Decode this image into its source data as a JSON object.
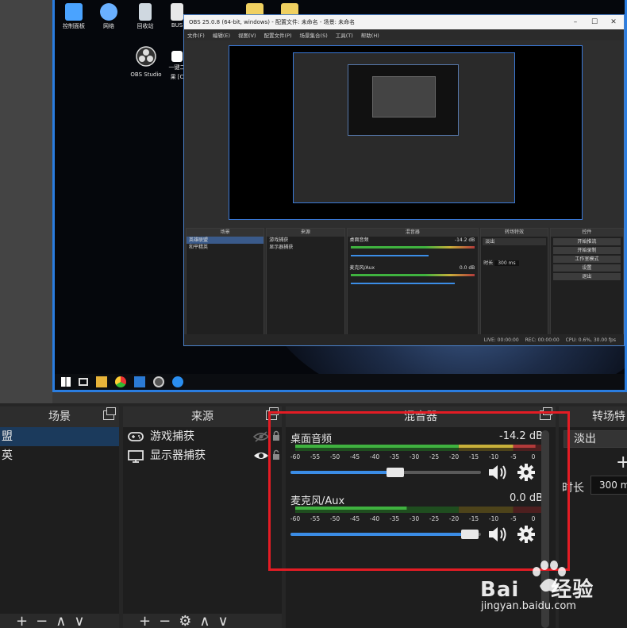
{
  "desktop": {
    "icons": [
      {
        "label": "控制面板",
        "color": "#4aa3ff"
      },
      {
        "label": "网络",
        "color": "#6ab0ff"
      },
      {
        "label": "回收站",
        "color": "#cfd8e0"
      },
      {
        "label": "BUS",
        "color": "#e8e8e8"
      },
      {
        "label": "",
        "color": "#f0d060"
      },
      {
        "label": "",
        "color": "#f0d060"
      }
    ],
    "obs_icon_label": "OBS Studio",
    "side_icon_label": "一键二",
    "side_icon_label2": "果 [C"
  },
  "nested_window": {
    "title": "OBS 25.0.8 (64-bit, windows) - 配置文件: 未命名 - 场景: 未命名",
    "menu": [
      "文件(F)",
      "编辑(E)",
      "视图(V)",
      "配置文件(P)",
      "场景集合(S)",
      "工具(T)",
      "帮助(H)"
    ],
    "panels": {
      "scenes_header": "场景",
      "scenes": [
        "英雄联盟",
        "和平精英"
      ],
      "sources_header": "来源",
      "sources": [
        "游戏捕获",
        "显示器捕获"
      ],
      "mixer_header": "混音器",
      "mixer_ch1": "桌面音频",
      "mixer_ch1_db": "-14.2 dB",
      "mixer_ch2": "麦克风/Aux",
      "mixer_ch2_db": "0.0 dB",
      "transitions_header": "转场特效",
      "transition_value": "淡出",
      "duration_label": "时长",
      "duration_value": "300 ms",
      "controls_header": "控件",
      "controls": [
        "开始推流",
        "开始录制",
        "工作室模式",
        "设置",
        "退出"
      ]
    },
    "status": [
      "LIVE: 00:00:00",
      "REC: 00:00:00",
      "CPU: 0.6%, 30.00 fps"
    ]
  },
  "docks": {
    "scenes": {
      "title": "场景",
      "items": [
        {
          "label": "盟",
          "selected": true
        },
        {
          "label": "英",
          "selected": false
        }
      ]
    },
    "sources": {
      "title": "来源",
      "items": [
        {
          "label": "游戏捕获",
          "icon": "gamepad-icon",
          "visible": false
        },
        {
          "label": "显示器捕获",
          "icon": "monitor-icon",
          "visible": true
        }
      ]
    },
    "mixer": {
      "title": "混音器",
      "channels": [
        {
          "name": "桌面音频",
          "db": "-14.2 dB",
          "volume_fraction": 0.55,
          "level_fraction": 0.97
        },
        {
          "name": "麦克风/Aux",
          "db": "0.0 dB",
          "volume_fraction": 0.94,
          "level_fraction": 0.45
        }
      ],
      "tick_labels": [
        "-60",
        "-55",
        "-50",
        "-45",
        "-40",
        "-35",
        "-30",
        "-25",
        "-20",
        "-15",
        "-10",
        "-5",
        "0"
      ]
    },
    "transitions": {
      "title": "转场特",
      "selected": "淡出",
      "duration_label": "时长",
      "duration_value": "300 m"
    },
    "footer_buttons": [
      "+",
      "−",
      "⚙",
      "∧",
      "∨"
    ]
  },
  "watermark": {
    "brand": "Bai",
    "brand2": "经验",
    "url": "jingyan.baidu.com"
  },
  "colors": {
    "accent": "#3b8de6",
    "highlight": "#e41c24",
    "meter_green": "#3fb23f",
    "meter_yellow": "#c8b03a",
    "meter_red": "#b23a3a"
  }
}
